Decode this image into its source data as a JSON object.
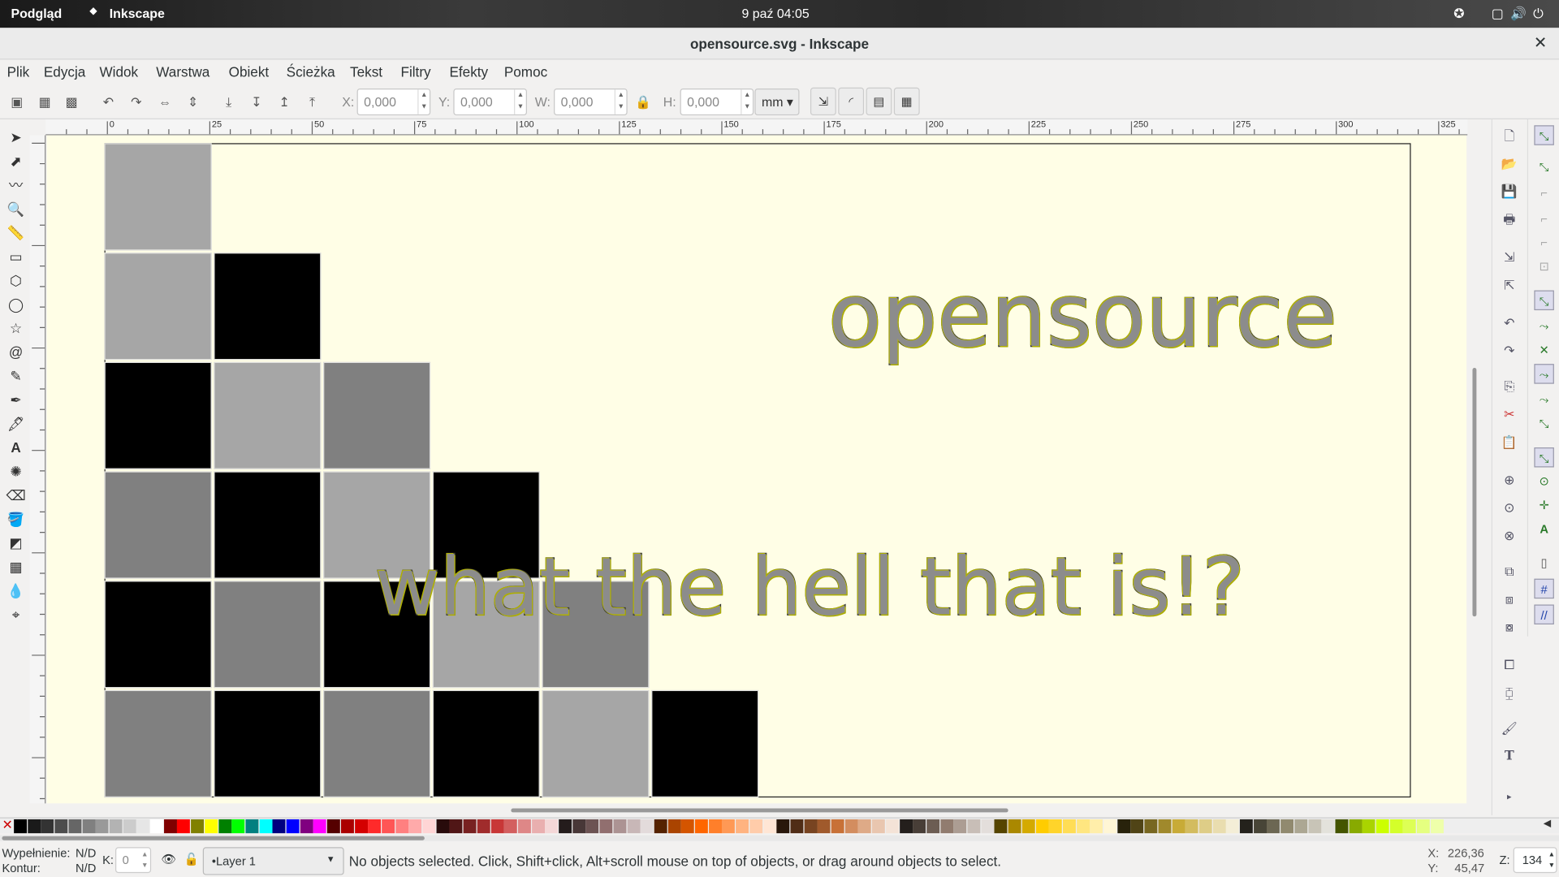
{
  "topbar": {
    "activities": "Podgląd",
    "app": "Inkscape",
    "clock": "9 paź  04:05"
  },
  "window": {
    "title": "opensource.svg - Inkscape"
  },
  "menu": [
    "Plik",
    "Edycja",
    "Widok",
    "Warstwa",
    "Obiekt",
    "Ścieżka",
    "Tekst",
    "Filtry",
    "Efekty",
    "Pomoc"
  ],
  "toolbar": {
    "x_label": "X:",
    "x_value": "0,000",
    "y_label": "Y:",
    "y_value": "0,000",
    "w_label": "W:",
    "w_value": "0,000",
    "h_label": "H:",
    "h_value": "0,000",
    "unit": "mm"
  },
  "ruler": {
    "h_ticks": [
      "0",
      "25",
      "50",
      "75",
      "100",
      "125",
      "150",
      "175",
      "200",
      "225",
      "250",
      "275",
      "300",
      "325"
    ]
  },
  "canvas": {
    "text1": "opensource",
    "text2": "what the hell that is!?"
  },
  "grid": [
    [
      "g1"
    ],
    [
      "g1",
      "bk"
    ],
    [
      "bk",
      "g1",
      "g2"
    ],
    [
      "g2",
      "bk",
      "g1",
      "bk"
    ],
    [
      "bk",
      "g2",
      "bk",
      "g1",
      "g2"
    ],
    [
      "g2",
      "bk",
      "g2",
      "bk",
      "g1",
      "bk"
    ]
  ],
  "status": {
    "fill_label": "Wypełnienie:",
    "fill_value": "N/D",
    "stroke_label": "Kontur:",
    "stroke_value": "N/D",
    "k_label": "K:",
    "k_value": "0",
    "layer": "•Layer 1",
    "message": "No objects selected. Click, Shift+click, Alt+scroll mouse on top of objects, or drag around objects to select.",
    "x_label": "X:",
    "x_coord": "226,36",
    "y_label": "Y:",
    "y_coord": "45,47",
    "zoom_label": "Z:",
    "zoom": "134"
  },
  "palette_colors": [
    "#000000",
    "#1a1a1a",
    "#333333",
    "#4d4d4d",
    "#666666",
    "#808080",
    "#999999",
    "#b3b3b3",
    "#cccccc",
    "#e6e6e6",
    "#ffffff",
    "#800000",
    "#ff0000",
    "#808000",
    "#ffff00",
    "#008000",
    "#00ff00",
    "#008080",
    "#00ffff",
    "#000080",
    "#0000ff",
    "#800080",
    "#ff00ff",
    "#550000",
    "#aa0000",
    "#d40000",
    "#ff2a2a",
    "#ff5555",
    "#ff8080",
    "#ffaaaa",
    "#ffd5d5",
    "#280b0b",
    "#501616",
    "#782121",
    "#a02c2c",
    "#c83737",
    "#d35f5f",
    "#de8787",
    "#e9afaf",
    "#f4d7d7",
    "#241c1c",
    "#483737",
    "#6c5353",
    "#916f6f",
    "#ac9393",
    "#c8b7b7",
    "#e3dbdb",
    "#552200",
    "#aa4400",
    "#d45500",
    "#ff6600",
    "#ff7f2a",
    "#ff9955",
    "#ffb380",
    "#ffccaa",
    "#ffe6d5",
    "#28170b",
    "#502d16",
    "#784421",
    "#a05a2c",
    "#c87137",
    "#d38d5f",
    "#deaa87",
    "#e9c6af",
    "#f4e3d7",
    "#241f1c",
    "#483e37",
    "#6c5d53",
    "#917c6f",
    "#ac9d93",
    "#c8beb7",
    "#e3dedb",
    "#554400",
    "#aa8800",
    "#d4aa00",
    "#ffcc00",
    "#ffd42a",
    "#ffdd55",
    "#ffe680",
    "#ffeeaa",
    "#fff6d5",
    "#28220b",
    "#504416",
    "#786721",
    "#a0892c",
    "#c8ab37",
    "#d3bc5f",
    "#decd87",
    "#e9ddaf",
    "#f4eed7",
    "#24221c",
    "#484537",
    "#6c6753",
    "#918a6f",
    "#aca793",
    "#c8c4b7",
    "#e3e2db",
    "#445500",
    "#88aa00",
    "#aad400",
    "#ccff00",
    "#d4ff2a",
    "#ddff55",
    "#e5ff80",
    "#eeffaa"
  ]
}
